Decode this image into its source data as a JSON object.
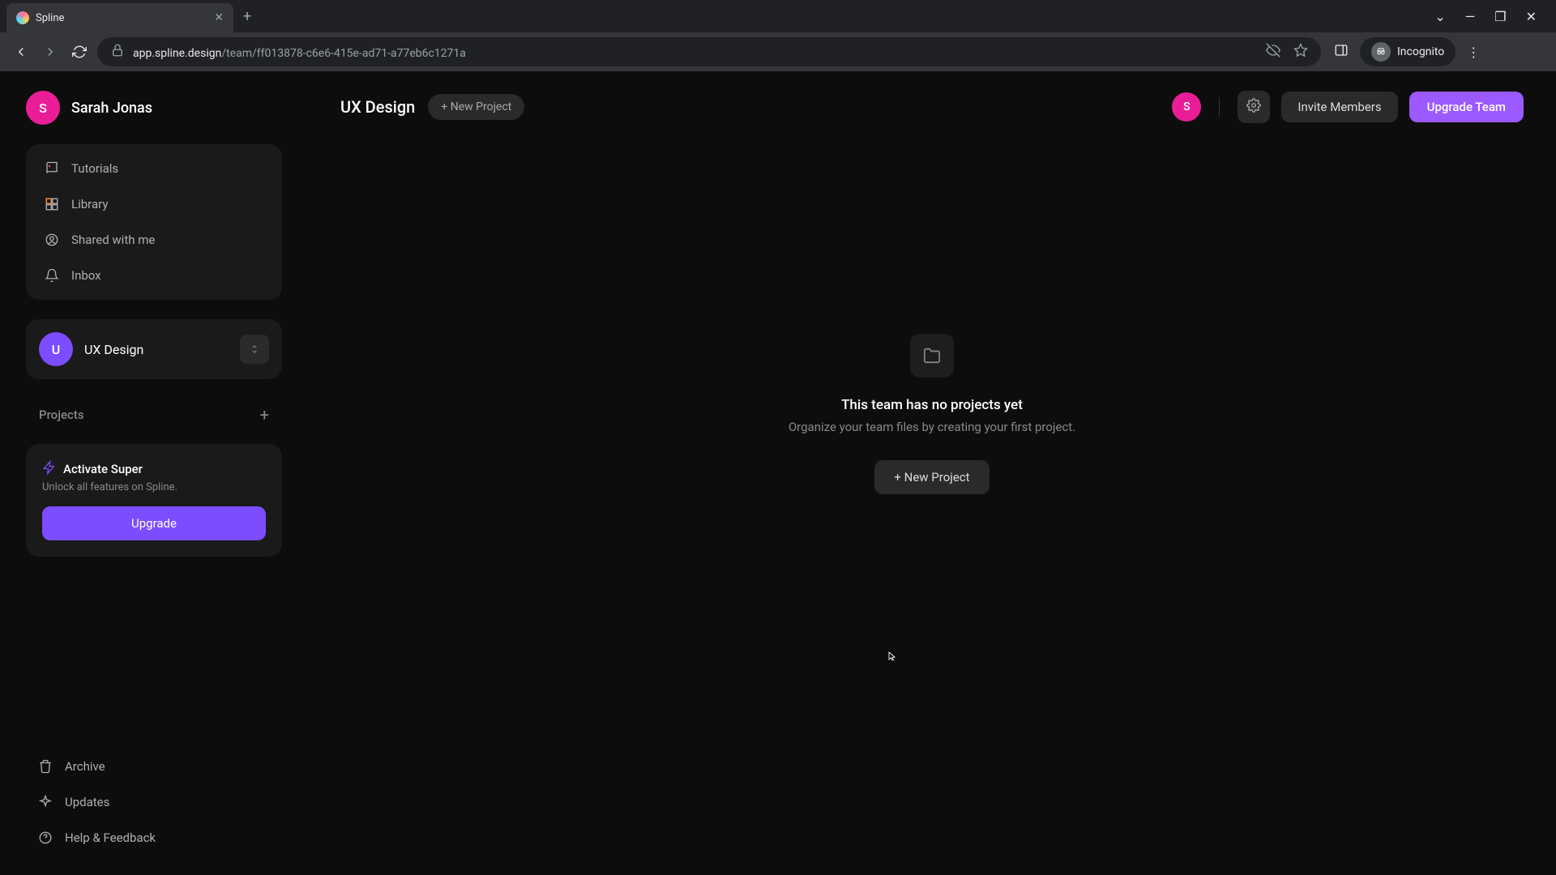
{
  "browser": {
    "tab_title": "Spline",
    "url_domain": "app.spline.design",
    "url_path": "/team/ff013878-c6e6-415e-ad71-a77eb6c1271a",
    "incognito_label": "Incognito"
  },
  "user": {
    "name": "Sarah Jonas",
    "initial": "S"
  },
  "sidebar": {
    "nav": {
      "tutorials": "Tutorials",
      "library": "Library",
      "shared": "Shared with me",
      "inbox": "Inbox"
    },
    "team": {
      "initial": "U",
      "name": "UX Design"
    },
    "projects_label": "Projects",
    "upgrade": {
      "title": "Activate Super",
      "subtitle": "Unlock all features on Spline.",
      "button": "Upgrade"
    },
    "bottom": {
      "archive": "Archive",
      "updates": "Updates",
      "help": "Help & Feedback"
    }
  },
  "main": {
    "title": "UX Design",
    "new_project_pill": "+ New Project",
    "member_initial": "S",
    "invite_label": "Invite Members",
    "upgrade_team_label": "Upgrade Team",
    "empty": {
      "title": "This team has no projects yet",
      "subtitle": "Organize your team files by creating your first project.",
      "button": "+ New Project"
    }
  }
}
